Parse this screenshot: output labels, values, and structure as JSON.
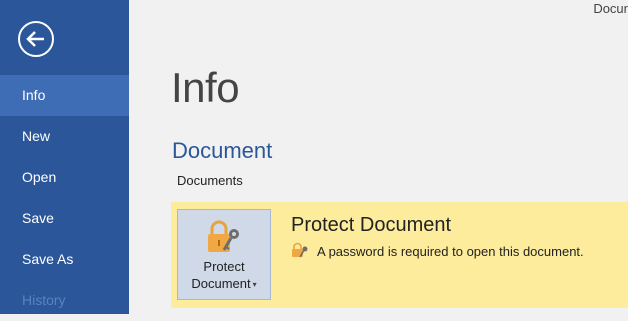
{
  "window": {
    "document_name": "Docur"
  },
  "sidebar": {
    "back_icon": "back-arrow-icon",
    "items": [
      {
        "label": "Info",
        "active": true
      },
      {
        "label": "New"
      },
      {
        "label": "Open"
      },
      {
        "label": "Save"
      },
      {
        "label": "Save As"
      },
      {
        "label": "History",
        "disabled": true
      }
    ]
  },
  "main": {
    "title": "Info",
    "section_title": "Document",
    "location": "Documents",
    "protect": {
      "button_line1": "Protect",
      "button_line2": "Document",
      "heading": "Protect Document",
      "description": "A password is required to open this document.",
      "icon": "lock-key-icon"
    }
  },
  "colors": {
    "sidebar": "#2b579a",
    "sidebar_active": "#3e6db5",
    "panel": "#fcec9c",
    "accent_text": "#2b579a"
  }
}
